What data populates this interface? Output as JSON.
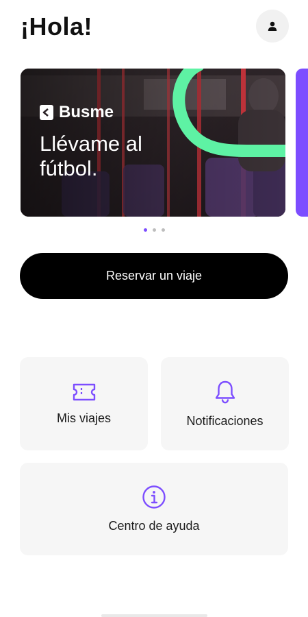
{
  "header": {
    "greeting": "¡Hola!",
    "profile_icon": "person-icon"
  },
  "carousel": {
    "brand": "Busme",
    "slogan": "Llévame al fútbol.",
    "slides_count": 3,
    "active_slide": 1,
    "accent_color": "#5ef2a4",
    "next_slide_color": "#7c4dff"
  },
  "actions": {
    "reserve_label": "Reservar un viaje"
  },
  "tiles": {
    "trips": {
      "label": "Mis viajes",
      "icon": "ticket-icon"
    },
    "notifications": {
      "label": "Notificaciones",
      "icon": "bell-icon"
    },
    "help": {
      "label": "Centro de ayuda",
      "icon": "info-icon"
    }
  },
  "theme": {
    "accent": "#7c4dff",
    "primary_button": "#000000",
    "tile_background": "#f6f6f6"
  }
}
